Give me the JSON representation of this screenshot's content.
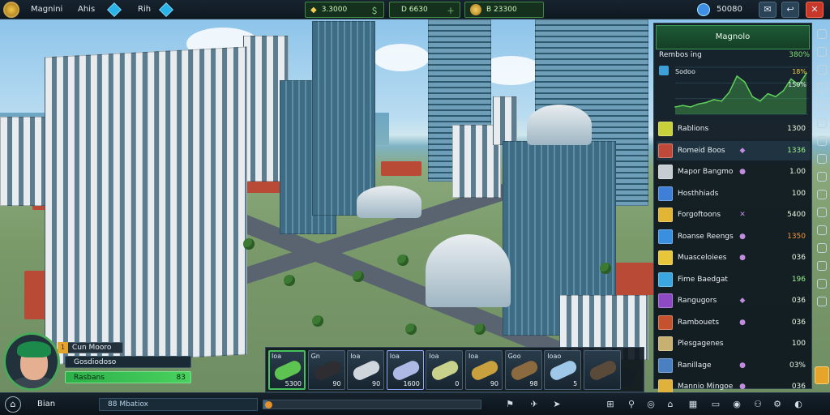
{
  "topbar": {
    "player_name": "Magnini",
    "tab1_label": "Ahis",
    "tab2_label": "Rih",
    "res_gold": "3.3000",
    "res_power": "D 6630",
    "res_coins": "B 23300",
    "premium": "50080",
    "icons": [
      "shield-logo-icon",
      "gem-icon",
      "diamond-icon",
      "coin-icon",
      "power-icon",
      "plus-icon",
      "premium-gem-icon",
      "gift-icon",
      "back-icon",
      "close-icon"
    ]
  },
  "panel": {
    "title": "Magnolo",
    "chart_title": "Rembos ing",
    "chart_value": "380%",
    "chart_data": {
      "type": "area",
      "series": [
        {
          "name": "Sodoo",
          "values": [
            5,
            6,
            5,
            7,
            8,
            10,
            9,
            15,
            26,
            22,
            12,
            9,
            14,
            12,
            16,
            24,
            20,
            28
          ]
        }
      ],
      "annotations": [
        "Sodoo",
        "18%",
        "150%"
      ],
      "ylim": [
        0,
        32
      ],
      "color": "#5fd25a"
    },
    "rows": [
      {
        "name": "Rablions",
        "trend": "",
        "value": "1300",
        "color": "#e8f6e0",
        "sq": "#c7d23a"
      },
      {
        "name": "Romeid Boos",
        "trend": "◆",
        "value": "1336",
        "color": "#9bf28a",
        "sq": "#c04a3a"
      },
      {
        "name": "Mapor Bangmo",
        "trend": "●",
        "value": "1.00",
        "color": "#e8f6e0",
        "sq": "#c7ccd2"
      },
      {
        "name": "Hosthhiads",
        "trend": "",
        "value": "100",
        "color": "#e8f6e0",
        "sq": "#3e7fd8"
      },
      {
        "name": "Forgoftoons",
        "trend": "✕",
        "value": "5400",
        "color": "#e8f6e0",
        "sq": "#e2b534"
      },
      {
        "name": "Roanse Reengs",
        "trend": "●",
        "value": "1350",
        "color": "#f2953a",
        "sq": "#3b8fe0"
      },
      {
        "name": "Muasceloiees",
        "trend": "●",
        "value": "036",
        "color": "#e8f6e0",
        "sq": "#e7c63a"
      },
      {
        "name": "Fime Baedgat",
        "trend": "",
        "value": "196",
        "color": "#9bf28a",
        "sq": "#3aa7e0"
      },
      {
        "name": "Rangugors",
        "trend": "◆",
        "value": "036",
        "color": "#e8f6e0",
        "sq": "#8e49c4"
      },
      {
        "name": "Rambouets",
        "trend": "●",
        "value": "036",
        "color": "#e8f6e0",
        "sq": "#c5522f"
      },
      {
        "name": "Plesgagenes",
        "trend": "",
        "value": "100",
        "color": "#e8f6e0",
        "sq": "#c8b071"
      },
      {
        "name": "Ranillage",
        "trend": "●",
        "value": "03%",
        "color": "#e8f6e0",
        "sq": "#4a7fc2"
      },
      {
        "name": "Mannio Mingoe",
        "trend": "●",
        "value": "036",
        "color": "#e8f6e0",
        "sq": "#e1b23b"
      }
    ]
  },
  "character": {
    "name": "Cun Mooro",
    "level": "1",
    "line1": "Gosdiodoso",
    "line2": "Rasbans",
    "line2_value": "83"
  },
  "hotbar": [
    {
      "label": "Ioa",
      "qty": "5300",
      "color": "#5dc452",
      "state": "active"
    },
    {
      "label": "Gn",
      "qty": "90",
      "color": "#2d2d32",
      "state": ""
    },
    {
      "label": "Ioa",
      "qty": "90",
      "color": "#cfd6dc",
      "state": ""
    },
    {
      "label": "Ioa",
      "qty": "1600",
      "color": "#aeb9e6",
      "state": "sel"
    },
    {
      "label": "Ioa",
      "qty": "0",
      "color": "#c8d28a",
      "state": ""
    },
    {
      "label": "Ioa",
      "qty": "90",
      "color": "#c9a03e",
      "state": ""
    },
    {
      "label": "Goo",
      "qty": "98",
      "color": "#8a6a3e",
      "state": ""
    },
    {
      "label": "Ioao",
      "qty": "5",
      "color": "#9fc8e8",
      "state": ""
    },
    {
      "label": "",
      "qty": "",
      "color": "#5a4a3a",
      "state": ""
    }
  ],
  "bottombar": {
    "label": "Bian",
    "message": "88 Mbatiox",
    "progress": 0.02,
    "icons": [
      "flag-icon",
      "fighter-icon",
      "arrow-icon",
      "grid-icon",
      "pin-icon",
      "globe-icon",
      "home-icon",
      "buildings-icon",
      "monitor-icon",
      "badge-icon",
      "group-icon",
      "settings-icon",
      "chat-icon"
    ]
  }
}
